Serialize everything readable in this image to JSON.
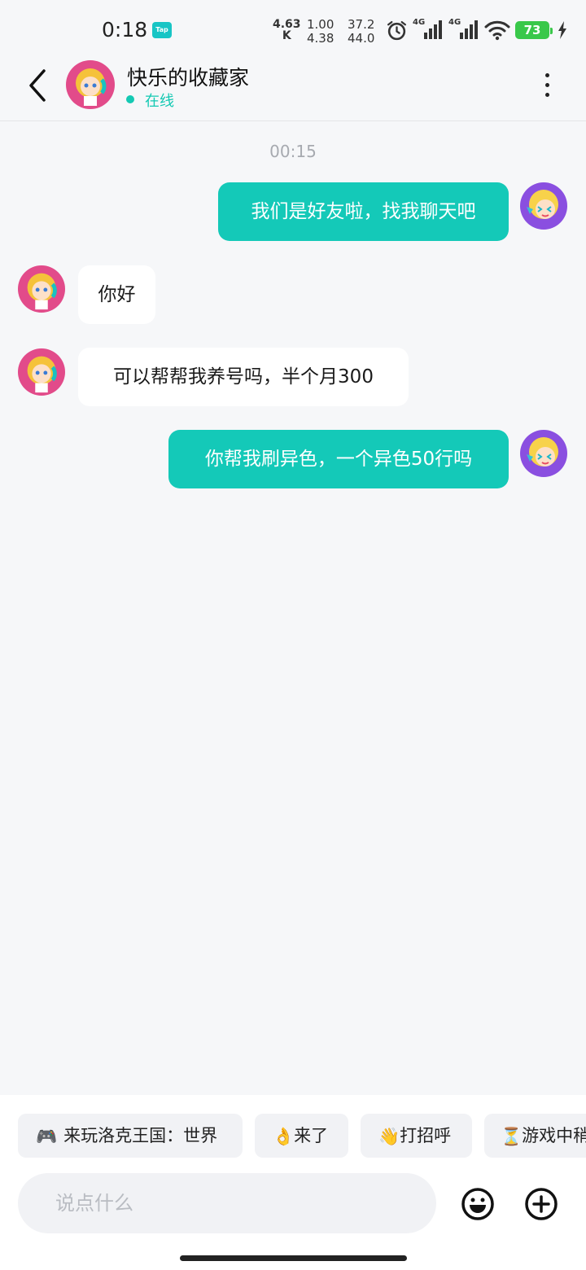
{
  "status_bar": {
    "time": "0:18",
    "tap_badge": "Tap",
    "net_speed_value": "4.63",
    "net_speed_unit": "K",
    "stat1_top": "1.00",
    "stat1_bottom": "4.38",
    "stat2_top": "37.2",
    "stat2_bottom": "44.0",
    "sim1_label": "4G",
    "sim2_label": "4G",
    "battery_level": "73",
    "icons": [
      "alarm-icon",
      "signal-icon",
      "signal-icon",
      "wifi-icon",
      "battery-icon",
      "charging-icon"
    ]
  },
  "header": {
    "contact_name": "快乐的收藏家",
    "status": "在线",
    "status_color": "#14c9b3"
  },
  "chat": {
    "timestamp": "00:15",
    "messages": [
      {
        "direction": "outgoing",
        "text": "我们是好友啦，找我聊天吧"
      },
      {
        "direction": "incoming",
        "text": "你好"
      },
      {
        "direction": "incoming",
        "text": "可以帮帮我养号吗，半个月300"
      },
      {
        "direction": "outgoing",
        "text": "你帮我刷异色，一个异色50行吗"
      }
    ],
    "accent_color": "#14c9b8"
  },
  "quick_replies": [
    {
      "icon": "🎮",
      "label": "来玩洛克王国：世界"
    },
    {
      "icon": "👌",
      "label": "来了"
    },
    {
      "icon": "👋",
      "label": "打招呼"
    },
    {
      "icon": "⏳",
      "label": "游戏中稍"
    }
  ],
  "composer": {
    "placeholder": "说点什么"
  }
}
